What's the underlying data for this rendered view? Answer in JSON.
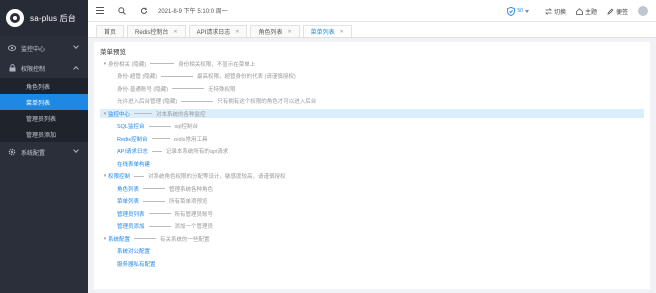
{
  "app": {
    "title": "sa-plus 后台"
  },
  "sidebar": {
    "items": [
      {
        "label": "监控中心",
        "icon": "eye-icon",
        "expanded": false
      },
      {
        "label": "权限控制",
        "icon": "lock-icon",
        "expanded": true,
        "children": [
          "角色列表",
          "菜单列表",
          "管理员列表",
          "管理员添加"
        ],
        "active_child": "菜单列表"
      },
      {
        "label": "系统配置",
        "icon": "gear-icon",
        "expanded": false
      }
    ]
  },
  "header": {
    "datetime": "2021-8-9 下午 5:10:0 周一",
    "shield_badge": "50",
    "switch_label": "切换",
    "home_label": "主题",
    "fav_label": "便签"
  },
  "tabs": [
    {
      "label": "首页",
      "closable": false,
      "active": false
    },
    {
      "label": "Redis控制台",
      "closable": true,
      "active": false
    },
    {
      "label": "API请求日志",
      "closable": true,
      "active": false
    },
    {
      "label": "角色列表",
      "closable": true,
      "active": false
    },
    {
      "label": "菜单列表",
      "closable": true,
      "active": true
    }
  ],
  "page": {
    "title": "菜单预览",
    "tree": [
      {
        "name": "身份相关 (隐藏)",
        "desc": "身份相关权限，不显示在菜单上",
        "level": 0,
        "expanded": true,
        "style": "gray",
        "highlight": false
      },
      {
        "name": "身份-超管 (隐藏)",
        "desc": "最高权限，超管身份的代表 (请谨慎授权)",
        "level": 1,
        "style": "gray",
        "highlight": false
      },
      {
        "name": "身份-普通账号 (隐藏)",
        "desc": "无特殊权限",
        "level": 1,
        "style": "gray",
        "highlight": false
      },
      {
        "name": "允许进入后台管理 (隐藏)",
        "desc": "只有拥有这个权限的角色才可以进入后台",
        "level": 1,
        "style": "gray",
        "highlight": false
      },
      {
        "name": "监控中心",
        "desc": "对本系统的各种监控",
        "level": 0,
        "expanded": true,
        "style": "blue",
        "highlight": true
      },
      {
        "name": "SQL监控台",
        "desc": "sql控制台",
        "level": 1,
        "style": "blue",
        "highlight": false
      },
      {
        "name": "Redis控制台",
        "desc": "redis常用工具",
        "level": 1,
        "style": "blue",
        "highlight": false
      },
      {
        "name": "API请求日志",
        "desc": "记录本系统所有的api请求",
        "level": 1,
        "style": "blue",
        "highlight": false
      },
      {
        "name": "在线表单构建",
        "desc": "",
        "level": 1,
        "style": "blue",
        "highlight": false
      },
      {
        "name": "权限控制",
        "desc": "对系统角色权限的分配等设计，敏感度较高，请谨慎授权",
        "level": 0,
        "expanded": true,
        "style": "blue",
        "highlight": false
      },
      {
        "name": "角色列表",
        "desc": "管理系统各种角色",
        "level": 1,
        "style": "blue",
        "highlight": false
      },
      {
        "name": "菜单列表",
        "desc": "所有菜单项预览",
        "level": 1,
        "style": "blue",
        "highlight": false
      },
      {
        "name": "管理员列表",
        "desc": "所有管理员账号",
        "level": 1,
        "style": "blue",
        "highlight": false
      },
      {
        "name": "管理员添加",
        "desc": "添加一个管理员",
        "level": 1,
        "style": "blue",
        "highlight": false
      },
      {
        "name": "系统配置",
        "desc": "有关系统的一些配置",
        "level": 0,
        "expanded": true,
        "style": "blue",
        "highlight": false
      },
      {
        "name": "系统对公配置",
        "desc": "",
        "level": 1,
        "style": "blue",
        "highlight": false
      },
      {
        "name": "服务器私有配置",
        "desc": "",
        "level": 1,
        "style": "blue",
        "highlight": false
      }
    ]
  },
  "colors": {
    "sidebar_bg": "#2a2f3a",
    "accent": "#1e88e5",
    "highlight_row": "#dbeefc"
  }
}
